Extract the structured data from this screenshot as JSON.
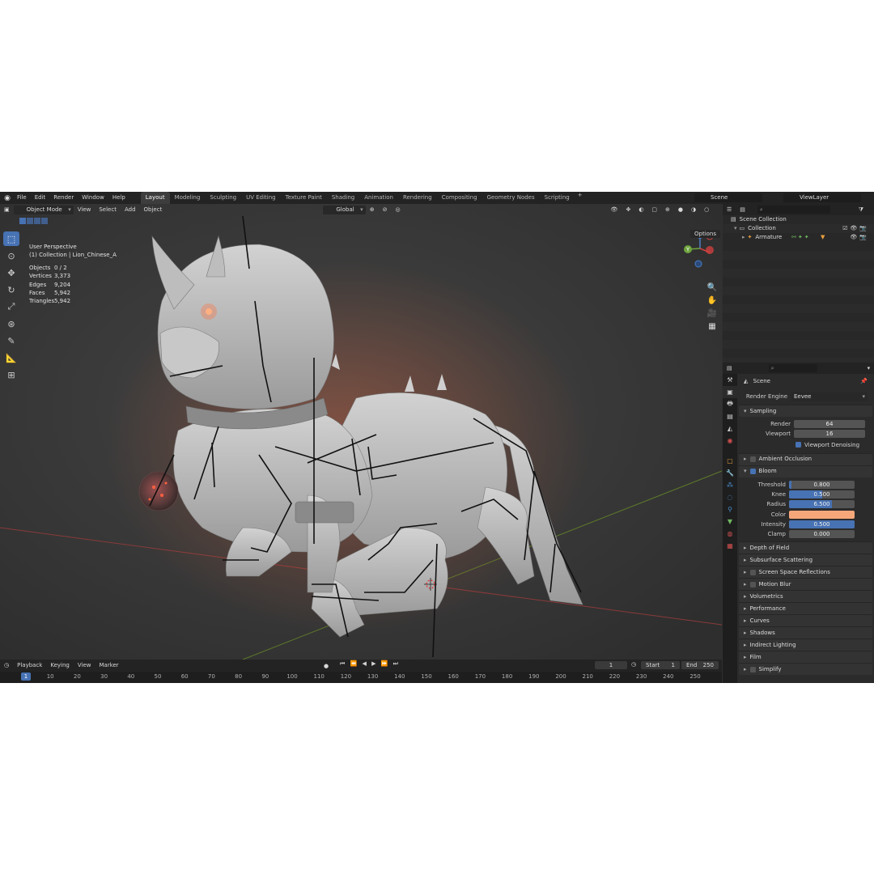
{
  "app": {
    "menu": [
      "File",
      "Edit",
      "Render",
      "Window",
      "Help"
    ],
    "workspaces": [
      "Layout",
      "Modeling",
      "Sculpting",
      "UV Editing",
      "Texture Paint",
      "Shading",
      "Animation",
      "Rendering",
      "Compositing",
      "Geometry Nodes",
      "Scripting"
    ],
    "active_workspace": "Layout",
    "add_tab": "+",
    "scene": "Scene",
    "view_layer": "ViewLayer"
  },
  "viewport": {
    "mode": "Object Mode",
    "menus": [
      "View",
      "Select",
      "Add",
      "Object"
    ],
    "transform": "Global",
    "options": "Options",
    "perspective": "User Perspective",
    "collection": "(1) Collection | Lion_Chinese_A",
    "stats": [
      {
        "k": "Objects",
        "v": "0 / 2"
      },
      {
        "k": "Vertices",
        "v": "3,373"
      },
      {
        "k": "Edges",
        "v": "9,204"
      },
      {
        "k": "Faces",
        "v": "5,942"
      },
      {
        "k": "Triangles",
        "v": "5,942"
      }
    ],
    "gizmo": {
      "x": "X",
      "y": "Y",
      "z": "Z"
    }
  },
  "timeline": {
    "menus": [
      "Playback",
      "Keying",
      "View",
      "Marker"
    ],
    "current_frame": "1",
    "start_label": "Start",
    "start": "1",
    "end_label": "End",
    "end": "250",
    "ruler": [
      "1",
      "10",
      "20",
      "30",
      "40",
      "50",
      "60",
      "70",
      "80",
      "90",
      "100",
      "110",
      "120",
      "130",
      "140",
      "150",
      "160",
      "170",
      "180",
      "190",
      "200",
      "210",
      "220",
      "230",
      "240",
      "250"
    ]
  },
  "outliner": {
    "scene_collection": "Scene Collection",
    "collection": "Collection",
    "armature": "Armature"
  },
  "properties": {
    "scene": "Scene",
    "render_engine_label": "Render Engine",
    "render_engine": "Eevee",
    "sampling": "Sampling",
    "render_label": "Render",
    "render_samples": "64",
    "viewport_label": "Viewport",
    "viewport_samples": "16",
    "viewport_denoising": "Viewport Denoising",
    "ambient_occlusion": "Ambient Occlusion",
    "bloom": "Bloom",
    "bloom_props": [
      {
        "label": "Threshold",
        "value": "0.800",
        "fill": 0.04
      },
      {
        "label": "Knee",
        "value": "0.500",
        "fill": 0.5
      },
      {
        "label": "Radius",
        "value": "6.500",
        "fill": 0.65
      },
      {
        "label": "Intensity",
        "value": "0.500",
        "fill": 1.0
      },
      {
        "label": "Clamp",
        "value": "0.000",
        "fill": 0.0
      }
    ],
    "color_label": "Color",
    "bloom_color": "#f5a77a",
    "panels": [
      "Depth of Field",
      "Subsurface Scattering",
      "Screen Space Reflections",
      "Motion Blur",
      "Volumetrics",
      "Performance",
      "Curves",
      "Shadows",
      "Indirect Lighting",
      "Film",
      "Simplify"
    ]
  }
}
